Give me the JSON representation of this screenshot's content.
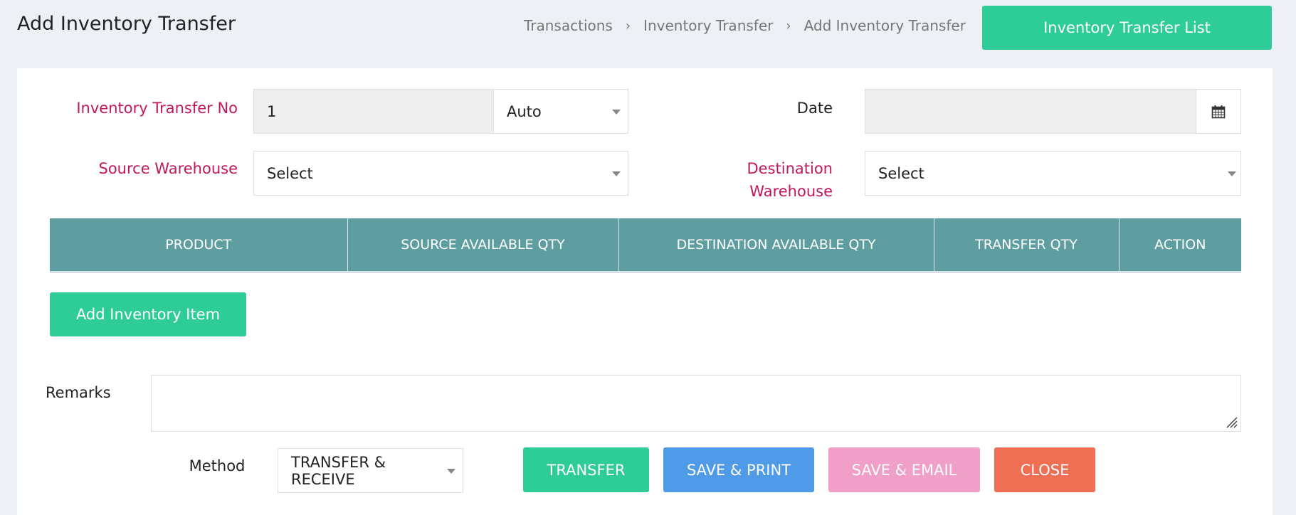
{
  "page": {
    "title": "Add Inventory Transfer"
  },
  "breadcrumb": {
    "items": [
      "Transactions",
      "Inventory Transfer",
      "Add Inventory Transfer"
    ],
    "separator": ">"
  },
  "header": {
    "list_button_label": "Inventory Transfer List"
  },
  "form": {
    "transfer_no_label": "Inventory Transfer No",
    "transfer_no_value": "1",
    "numbering_mode_value": "Auto",
    "date_label": "Date",
    "date_value": "",
    "source_warehouse_label": "Source Warehouse",
    "source_warehouse_value": "Select",
    "destination_warehouse_label_line1": "Destination",
    "destination_warehouse_label_line2": "Warehouse",
    "destination_warehouse_value": "Select"
  },
  "table": {
    "columns": [
      "PRODUCT",
      "SOURCE AVAILABLE QTY",
      "DESTINATION AVAILABLE QTY",
      "TRANSFER QTY",
      "ACTION"
    ],
    "rows": []
  },
  "actions": {
    "add_item_label": "Add Inventory Item",
    "remarks_label": "Remarks",
    "remarks_value": "",
    "method_label": "Method",
    "method_value": "TRANSFER & RECEIVE",
    "transfer_label": "TRANSFER",
    "save_print_label": "SAVE & PRINT",
    "save_email_label": "SAVE & EMAIL",
    "close_label": "CLOSE"
  },
  "colors": {
    "primary_green": "#2ecc96",
    "table_header": "#5f9ea0",
    "required_label": "#c2185b",
    "save_print_blue": "#4f9be8",
    "save_email_pink": "#f0a0c8",
    "close_orange": "#ef6f55"
  },
  "icons": {
    "date_picker": "calendar-icon",
    "select_caret": "caret-down-icon",
    "breadcrumb_separator": "chevron-right-icon",
    "textarea_resize": "resize-grip-icon"
  }
}
